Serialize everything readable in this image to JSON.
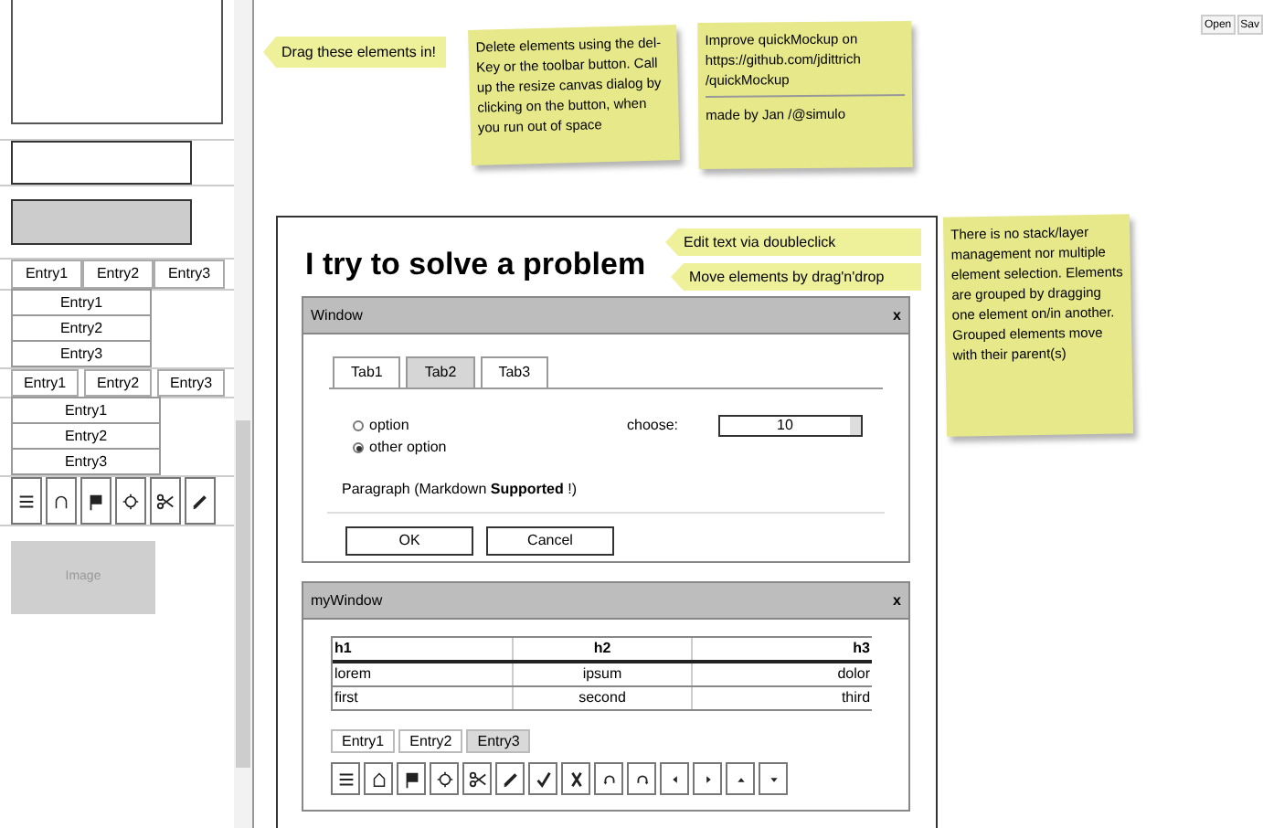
{
  "toolbar": {
    "buttons": [
      "Open",
      "Sav"
    ]
  },
  "palette": {
    "button_bar": [
      "Entry1",
      "Entry2",
      "Entry3"
    ],
    "list": [
      "Entry1",
      "Entry2",
      "Entry3"
    ],
    "tabs": [
      "Entry1",
      "Entry2",
      "Entry3"
    ],
    "list_2": [
      "Entry1",
      "Entry2",
      "Entry3"
    ],
    "image_label": "Image"
  },
  "notes": [
    {
      "kind": "arrow",
      "text": "Drag these elements in!"
    },
    {
      "kind": "sticky",
      "paragraphs": [
        "Delete elements using the del-Key or the toolbar button. Call up the resize canvas dialog by clicking on the button, when you run out of space"
      ]
    },
    {
      "kind": "sticky",
      "paragraphs": [
        "Improve quickMockup on https://github.com/jdittrich /quickMockup",
        "made by Jan /@simulo"
      ]
    },
    {
      "kind": "arrow",
      "text": "Edit text via doubleclick"
    },
    {
      "kind": "arrow",
      "text": "Move elements by drag'n'drop"
    },
    {
      "kind": "sticky",
      "paragraphs": [
        "There is no stack/layer management nor multiple element selection. Elements are grouped by dragging one element on/in another. Grouped elements move with their parent(s)"
      ]
    }
  ],
  "canvas": {
    "heading": "I try to solve a problem",
    "window": {
      "title": "Window",
      "close": "x",
      "tabs": [
        {
          "label": "Tab1",
          "selected": false
        },
        {
          "label": "Tab2",
          "selected": true
        },
        {
          "label": "Tab3",
          "selected": false
        }
      ],
      "radios": [
        {
          "label": "option",
          "selected": false
        },
        {
          "label": "other option",
          "selected": true
        }
      ],
      "choose_label": "choose:",
      "spinner_value": "10",
      "paragraph": "Paragraph (Markdown **Supported** !)",
      "buttons": [
        "OK",
        "Cancel"
      ]
    },
    "my_window": {
      "title": "myWindow",
      "close": "x",
      "table": {
        "columns": [
          "h1",
          "h2",
          "h3"
        ],
        "rows": [
          [
            "lorem",
            "ipsum",
            "dolor"
          ],
          [
            "first",
            "second",
            "third"
          ]
        ]
      },
      "segments": [
        {
          "label": "Entry1",
          "selected": false
        },
        {
          "label": "Entry2",
          "selected": false
        },
        {
          "label": "Entry3",
          "selected": true
        }
      ]
    }
  }
}
